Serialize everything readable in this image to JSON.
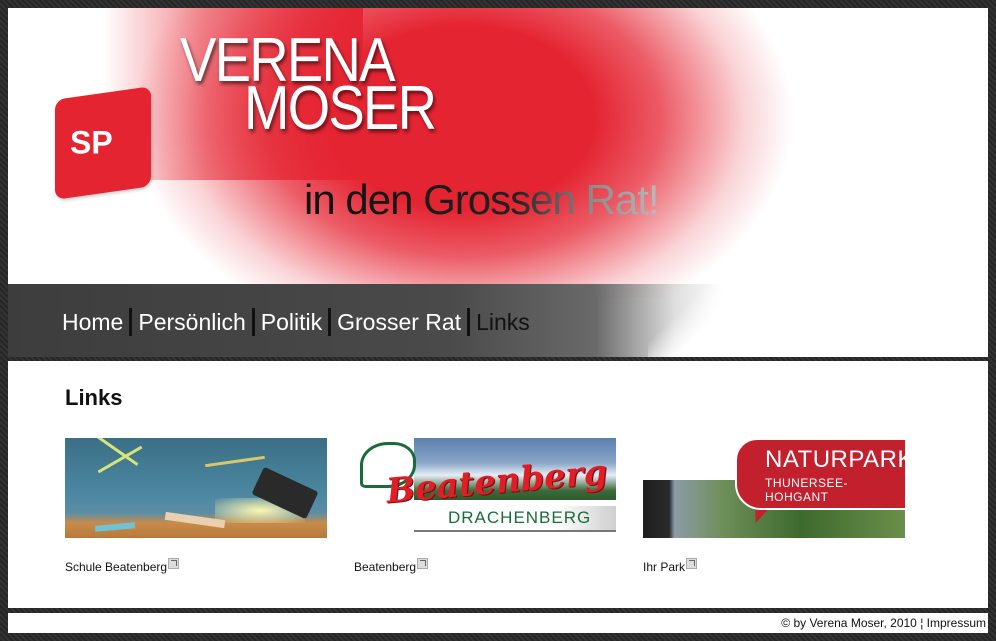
{
  "header": {
    "logo_text": "SP",
    "name_line1": "VERENA",
    "name_line2": "MOSER",
    "slogan": "in den Grossen Rat!"
  },
  "nav": {
    "items": [
      {
        "label": "Home"
      },
      {
        "label": "Persönlich"
      },
      {
        "label": "Politik"
      },
      {
        "label": "Grosser Rat"
      },
      {
        "label": "Links"
      }
    ],
    "active": "Links"
  },
  "content": {
    "title": "Links",
    "cards": [
      {
        "caption": "Schule Beatenberg"
      },
      {
        "caption": "Beatenberg",
        "brand": "Beatenberg",
        "sub": "DRACHENBERG"
      },
      {
        "caption": "Ihr Park",
        "title1": "NATURPARK",
        "title2": "THUNERSEE-HOHGANT"
      }
    ]
  },
  "footer": {
    "copyright": "© by Verena Moser, 2010 ¦ ",
    "impressum": "Impressum"
  },
  "colors": {
    "brand_red": "#e52432",
    "nav_bg": "#444444",
    "page_frame": "#2b2b2b"
  }
}
